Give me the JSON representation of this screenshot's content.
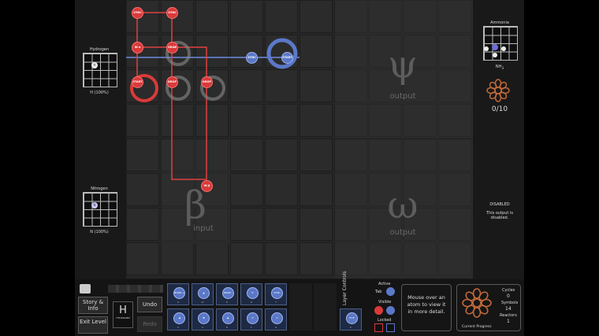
{
  "inputs": {
    "alpha": {
      "name": "Hydrogen",
      "atom_symbol": "H",
      "percent": "H (100%)"
    },
    "beta": {
      "name": "Nitrogen",
      "atom_symbol": "N",
      "percent": "N (100%)"
    }
  },
  "outputs": {
    "psi": {
      "name": "Ammonia",
      "formula": "NH",
      "formula_sub": "3",
      "count": "0/10"
    },
    "omega": {
      "status_title": "DISABLED",
      "status_text": "This output is disabled."
    }
  },
  "zones": {
    "beta_symbol": "β",
    "beta_label": "input",
    "psi_symbol": "ψ",
    "psi_label": "output",
    "omega_symbol": "ω",
    "omega_label": "output"
  },
  "instructions_red": [
    {
      "label": "SYNC"
    },
    {
      "label": "SYNC"
    },
    {
      "label": "IN α"
    },
    {
      "label": "GRAB"
    },
    {
      "label": "START"
    },
    {
      "label": "DROP"
    },
    {
      "label": "DROP"
    },
    {
      "label": "IN β"
    }
  ],
  "instructions_blue": [
    {
      "label": "SYNC"
    },
    {
      "label": "START"
    }
  ],
  "bottom": {
    "story_label": "Story & Info",
    "exit_label": "Exit Level",
    "undo_label": "Undo",
    "redo_label": "Redo",
    "element_symbol": "H",
    "element_name": "HYDROGEN",
    "palette": [
      {
        "label": "BOND +",
        "key": "Q"
      },
      {
        "label": "▲",
        "key": "W"
      },
      {
        "label": "BOND -",
        "key": "E"
      },
      {
        "label": "⇄",
        "key": "R"
      },
      {
        "label": "SYNC",
        "key": "T"
      },
      {
        "label": "◀",
        "key": "A"
      },
      {
        "label": "▼",
        "key": "S"
      },
      {
        "label": "▶",
        "key": "D"
      },
      {
        "label": "↻",
        "key": "F"
      },
      {
        "label": "↺",
        "key": "G"
      },
      {
        "label": "FLIP",
        "key": "K"
      }
    ],
    "layer_controls": "Layer Controls",
    "active_label": "Active",
    "tab_label": "Tab",
    "visible_label": "Visible",
    "locked_label": "Locked",
    "hover_help": "Mouse over an atom to view it in more detail.",
    "current_progress": "Current Progress",
    "cycles_label": "Cycles",
    "cycles_value": "0",
    "symbols_label": "Symbols",
    "symbols_value": "14",
    "reactors_label": "Reactors",
    "reactors_value": "1"
  },
  "colors": {
    "red": "#d93a3a",
    "blue": "#5b78c8",
    "orange": "#c0683a"
  }
}
